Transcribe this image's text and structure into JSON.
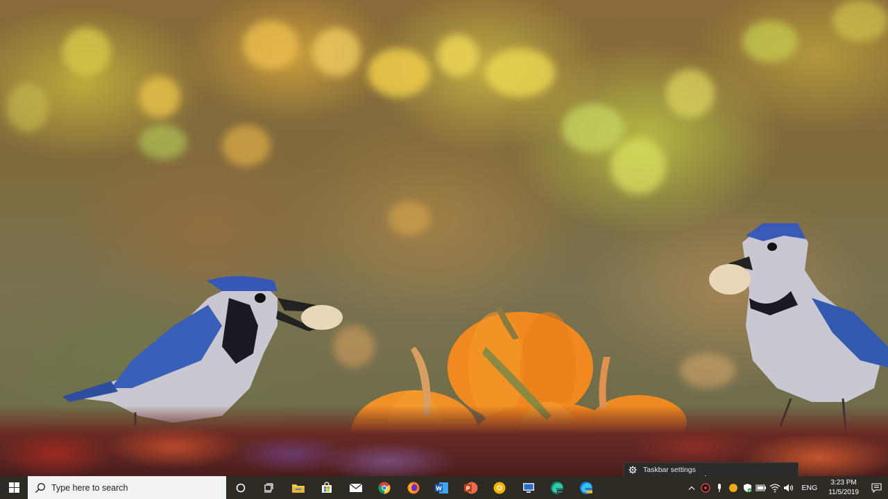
{
  "taskbar": {
    "search": {
      "placeholder": "Type here to search"
    },
    "pinned_apps": [
      {
        "name": "cortana-icon"
      },
      {
        "name": "task-view-icon"
      },
      {
        "name": "file-explorer-icon"
      },
      {
        "name": "microsoft-store-icon"
      },
      {
        "name": "mail-icon"
      },
      {
        "name": "chrome-icon"
      },
      {
        "name": "firefox-icon"
      },
      {
        "name": "word-icon"
      },
      {
        "name": "powerpoint-icon"
      },
      {
        "name": "chrome-canary-icon"
      },
      {
        "name": "remote-desktop-icon"
      },
      {
        "name": "edge-dev-icon"
      },
      {
        "name": "edge-canary-icon"
      }
    ],
    "tray": {
      "language": "ENG",
      "time": "3:23 PM",
      "date": "11/5/2019"
    }
  },
  "tooltip": {
    "label": "Taskbar settings"
  },
  "colors": {
    "taskbar_bg": "#2e2b24",
    "search_bg": "#f2f2f2",
    "tooltip_bg": "#2b2b2b"
  }
}
